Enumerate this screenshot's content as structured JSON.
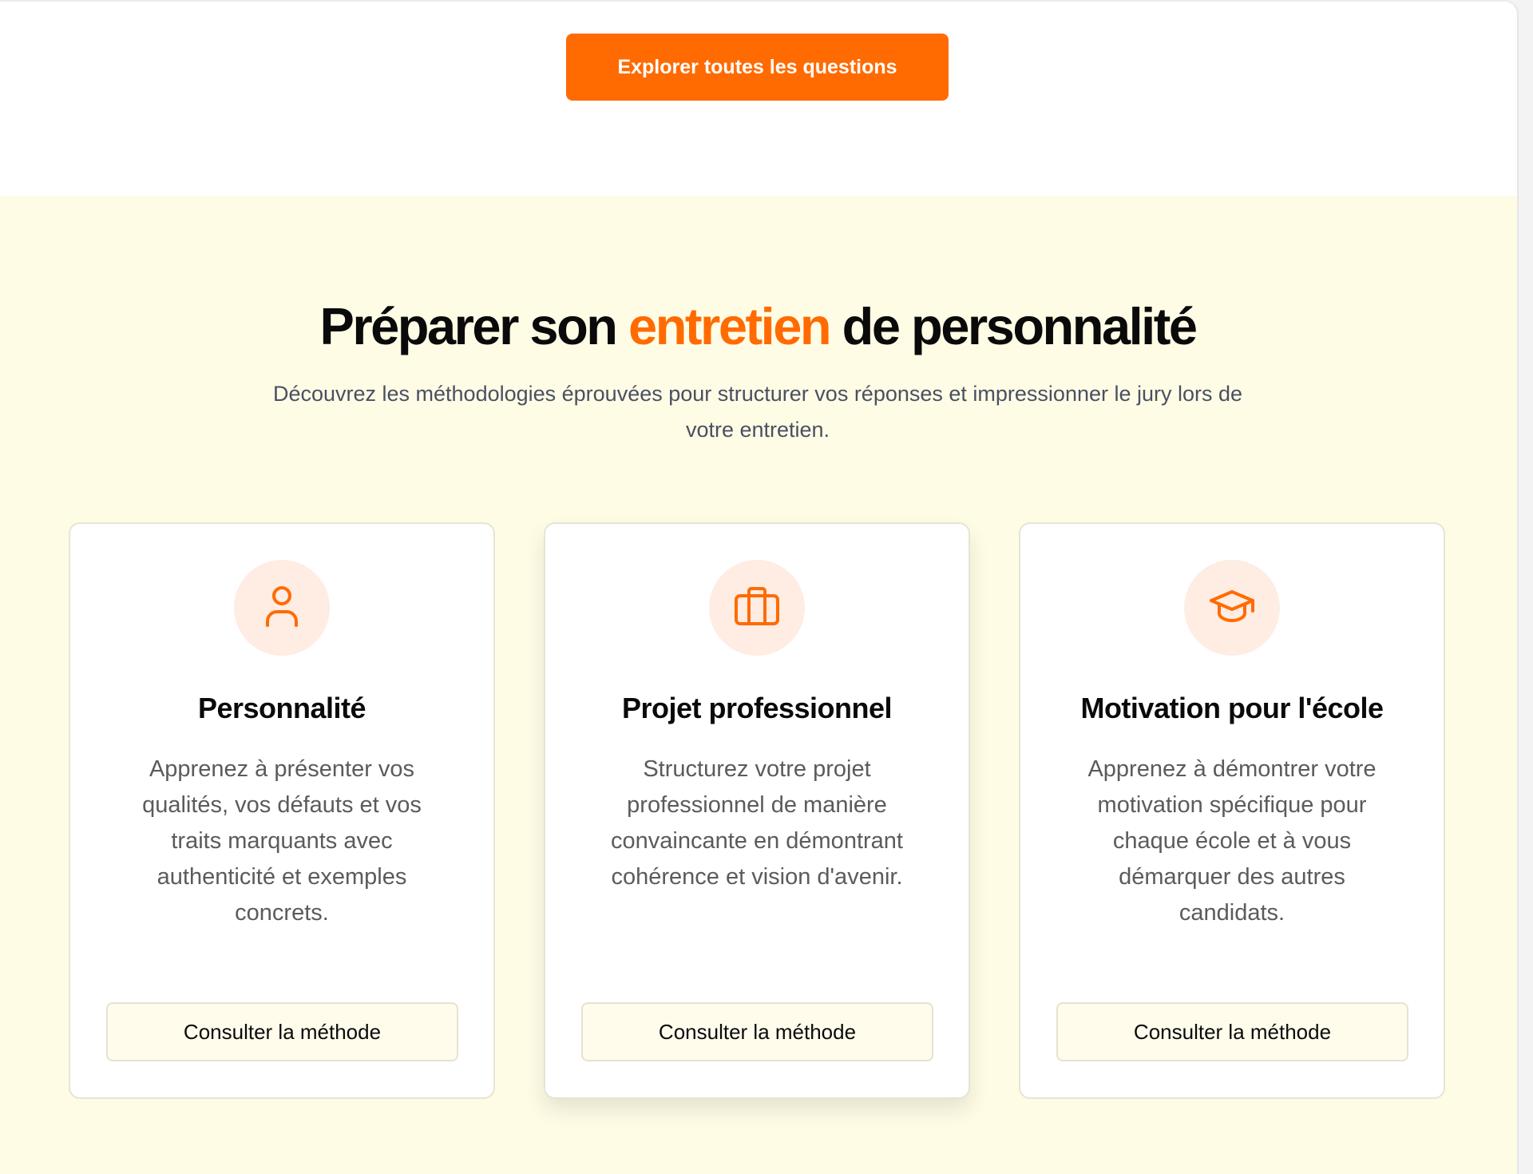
{
  "top": {
    "cta_label": "Explorer toutes les questions"
  },
  "prep": {
    "heading_before": "Préparer son ",
    "heading_accent": "entretien",
    "heading_after": " de personnalité",
    "subtitle": "Découvrez les méthodologies éprouvées pour structurer vos réponses et impressionner le jury lors de votre entretien.",
    "cards": [
      {
        "icon": "user-icon",
        "title": "Personnalité",
        "description": "Apprenez à présenter vos qualités, vos défauts et vos traits marquants avec authenticité et exemples concrets.",
        "button_label": "Consulter la méthode"
      },
      {
        "icon": "briefcase-icon",
        "title": "Projet professionnel",
        "description": "Structurez votre projet professionnel de manière convaincante en démontrant cohérence et vision d'avenir.",
        "button_label": "Consulter la méthode"
      },
      {
        "icon": "graduation-cap-icon",
        "title": "Motivation pour l'école",
        "description": "Apprenez à démontrer votre motivation spécifique pour chaque école et à vous démarquer des autres candidats.",
        "button_label": "Consulter la méthode"
      }
    ]
  },
  "colors": {
    "accent": "#ff6b00",
    "section_bg": "#fffce6",
    "icon_circle_bg": "#ffece3"
  }
}
